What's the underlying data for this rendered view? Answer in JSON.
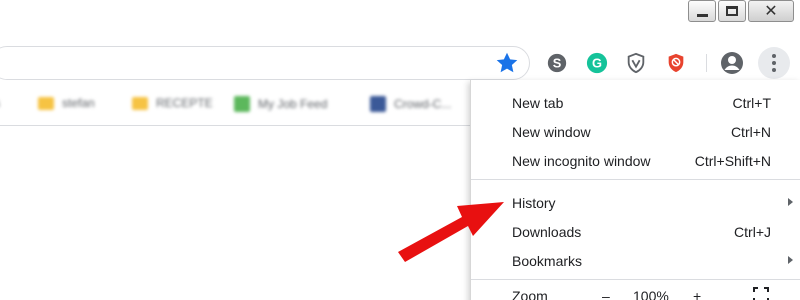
{
  "window_controls": {
    "minimize": "minimize",
    "maximize": "maximize",
    "close": "close"
  },
  "toolbar": {
    "bookmark_icon": "star-icon",
    "accent_color": "#1a73e8",
    "extensions": [
      {
        "name": "skype-icon",
        "color": "#5f6368"
      },
      {
        "name": "grammarly-icon",
        "color": "#15c39a"
      },
      {
        "name": "shield-v-icon",
        "color": "#5f6368"
      },
      {
        "name": "adblock-icon",
        "color": "#e8432e"
      }
    ],
    "profile_icon": "account-icon",
    "menu_icon": "three-dots-icon"
  },
  "bookmarks": [
    {
      "icon": "folder-icon",
      "label": "stefan"
    },
    {
      "icon": "folder-icon",
      "label": "RECEPTE"
    },
    {
      "icon": "upwork-icon",
      "label": "My Job Feed"
    },
    {
      "icon": "facebook-icon",
      "label": "Crowd-C..."
    }
  ],
  "menu": {
    "items": [
      {
        "label": "New tab",
        "shortcut": "Ctrl+T"
      },
      {
        "label": "New window",
        "shortcut": "Ctrl+N"
      },
      {
        "label": "New incognito window",
        "shortcut": "Ctrl+Shift+N"
      },
      {
        "label": "History",
        "shortcut": ""
      },
      {
        "label": "Downloads",
        "shortcut": "Ctrl+J"
      },
      {
        "label": "Bookmarks",
        "shortcut": ""
      }
    ],
    "zoom": {
      "label": "Zoom",
      "minus": "–",
      "level": "100%",
      "plus": "+"
    }
  },
  "annotation": {
    "arrow_color": "#e81010"
  }
}
